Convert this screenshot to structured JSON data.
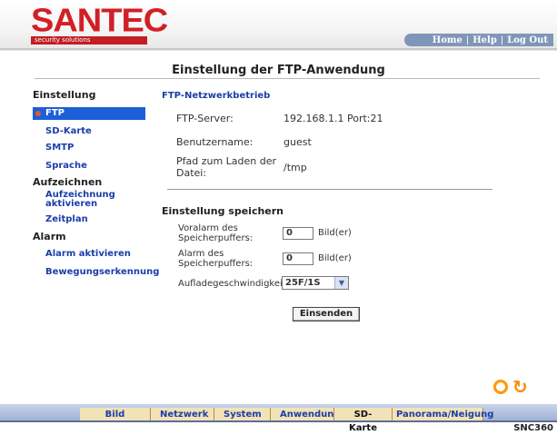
{
  "brand": {
    "logo_text": "SANTEC",
    "tagline": "security solutions"
  },
  "topnav": {
    "home": "Home",
    "help": "Help",
    "logout": "Log Out",
    "separator": "|"
  },
  "page_title": "Einstellung der FTP-Anwendung",
  "sidebar": {
    "groups": [
      {
        "heading": "Einstellung",
        "items": [
          {
            "label": "FTP",
            "active": true
          },
          {
            "label": "SD-Karte"
          },
          {
            "label": "SMTP"
          },
          {
            "label": "Sprache"
          }
        ]
      },
      {
        "heading": "Aufzeichnen",
        "items": [
          {
            "label": "Aufzeichnung aktivieren"
          },
          {
            "label": "Zeitplan"
          }
        ]
      },
      {
        "heading": "Alarm",
        "items": [
          {
            "label": "Alarm aktivieren"
          },
          {
            "label": "Bewegungserkennung"
          }
        ]
      }
    ]
  },
  "ftp": {
    "section_title": "FTP-Netzwerkbetrieb",
    "server_label": "FTP-Server:",
    "server_value": "192.168.1.1  Port:21",
    "user_label": "Benutzername:",
    "user_value": "guest",
    "path_label": "Pfad zum Laden der Datei:",
    "path_value": "/tmp"
  },
  "save": {
    "section_title": "Einstellung speichern",
    "prealarm_label": "Voralarm des Speicherpuffers:",
    "prealarm_value": "0",
    "alarm_label": "Alarm des Speicherpuffers:",
    "alarm_value": "0",
    "unit": "Bild(er)",
    "speed_label": "Aufladegeschwindigkeit:",
    "speed_value": "25F/1S",
    "submit": "Einsenden"
  },
  "tabs": [
    {
      "label": "Bild"
    },
    {
      "label": "Netzwerk"
    },
    {
      "label": "System"
    },
    {
      "label": "Anwendung"
    },
    {
      "label": "SD-Karte"
    },
    {
      "label": "Panorama/Neigung"
    }
  ],
  "model": "SNC360",
  "colors": {
    "brand_red": "#d21f26",
    "link_blue": "#1a3ea8",
    "active_blue": "#1d5fd8",
    "tab_bg": "#f2e2b8",
    "accent_orange": "#ff9900"
  }
}
